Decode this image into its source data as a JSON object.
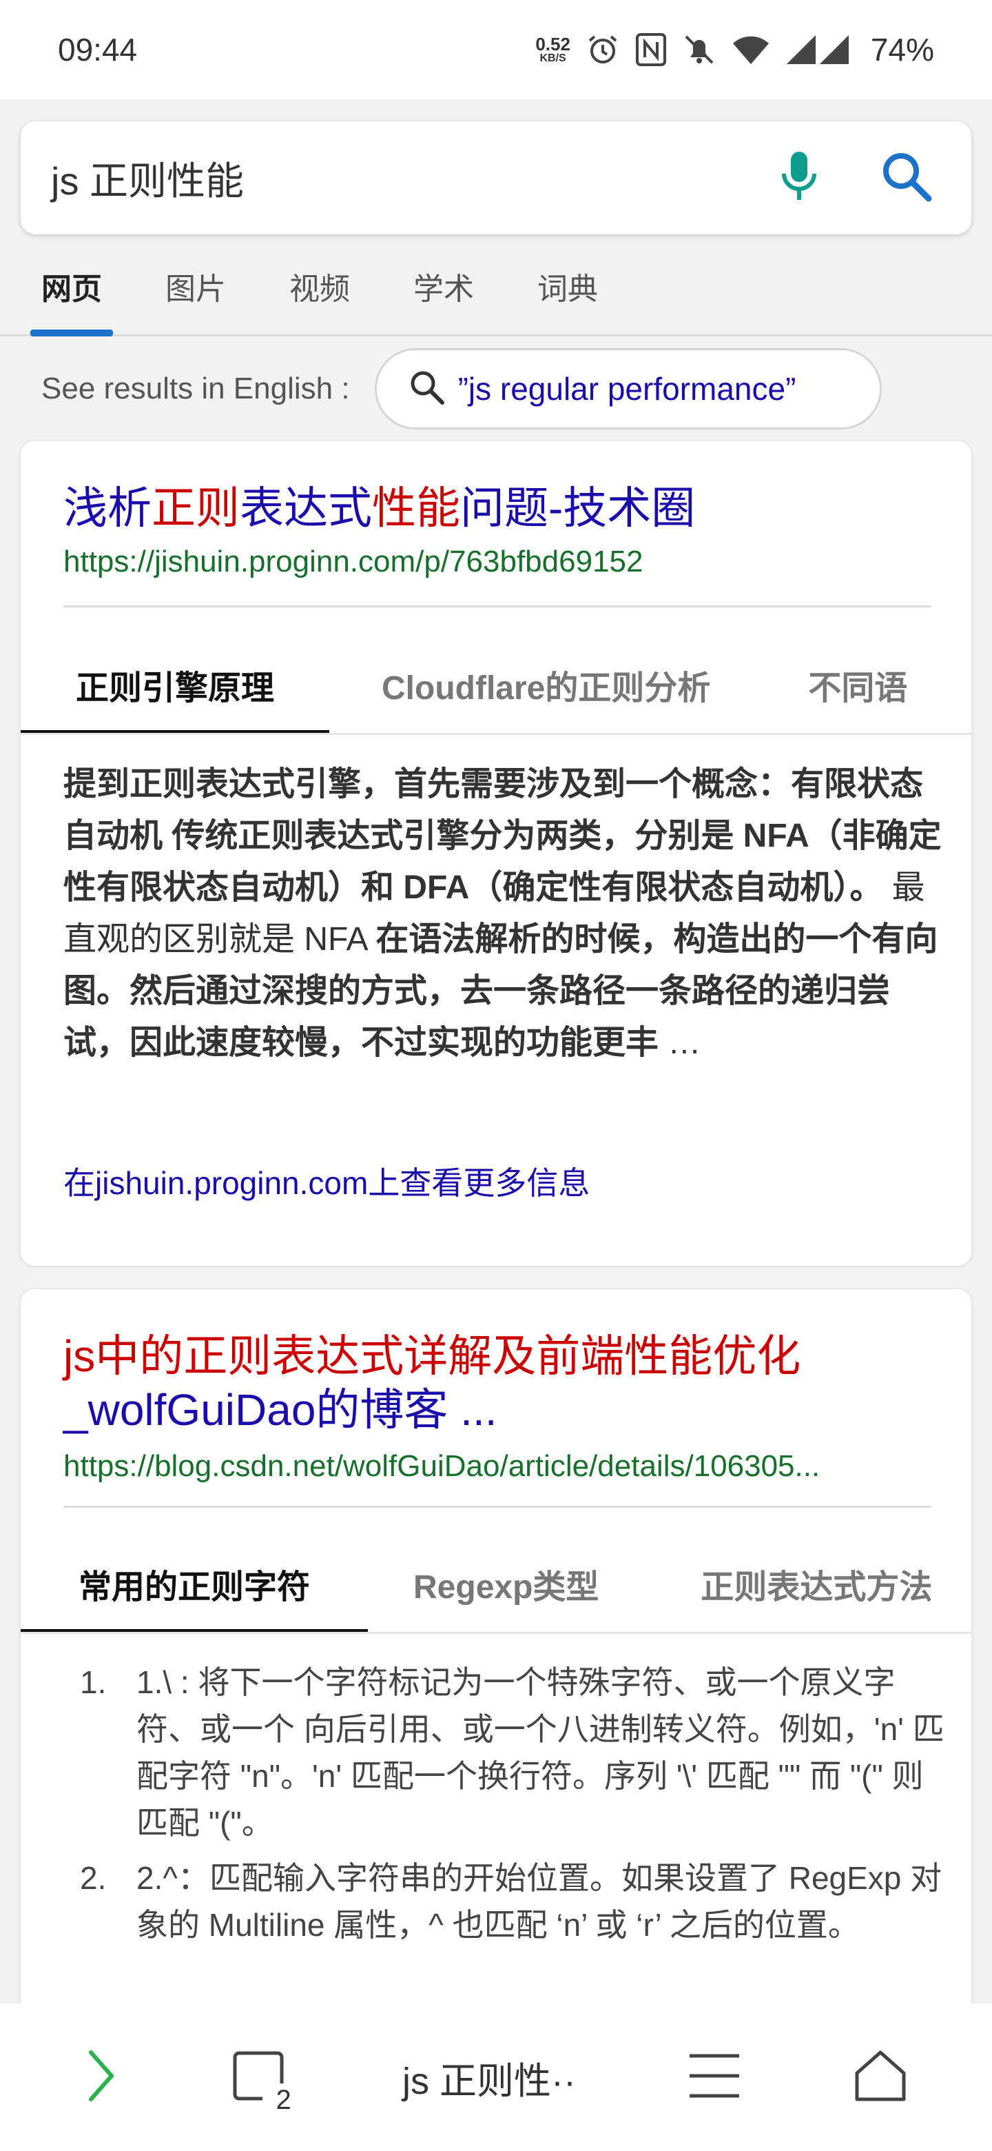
{
  "status_bar": {
    "time": "09:44",
    "net_speed": "0.52",
    "net_unit": "KB/S",
    "battery": "74%"
  },
  "search": {
    "query": "js 正则性能"
  },
  "search_tabs": [
    "网页",
    "图片",
    "视频",
    "学术",
    "词典"
  ],
  "english": {
    "label": "See results in English :",
    "suggestion": "”js regular performance”"
  },
  "results": [
    {
      "title_parts": [
        "浅析",
        "正则",
        "表达式",
        "性能",
        "问题-技术圈"
      ],
      "url": "https://jishuin.proginn.com/p/763bfbd69152",
      "tabs": [
        "正则引擎原理",
        "Cloudflare的正则分析",
        "不同语"
      ],
      "snippet_parts": [
        "提到正则表达式引擎，首先需要涉及到一个概念：有限状态自动机 传统正则表达式引擎分为两类，分别是 NFA（非确定性有限状态自动机）和 DFA（确定性有限状态自动机）。",
        " 最直观的区别就是 NFA ",
        "在语法解析的时候，构造出的一个有向图。然后通过深搜的方式，去一条路径一条路径的递归尝试，因此速度较慢，不过实现的功能更丰",
        " …"
      ],
      "more_link": "在jishuin.proginn.com上查看更多信息"
    },
    {
      "title_parts": [
        "js中的正则表达式详解及前端性能优化",
        "_wolfGuiDao的博客 ..."
      ],
      "url": "https://blog.csdn.net/wolfGuiDao/article/details/106305...",
      "tabs": [
        "常用的正则字符",
        "Regexp类型",
        "正则表达式方法"
      ],
      "list_items": [
        {
          "num": "1.",
          "text": "1.\\ : 将下一个字符标记为一个特殊字符、或一个原义字符、或一个 向后引用、或一个八进制转义符。例如，'n' 匹配字符 \"n\"。'n' 匹配一个换行符。序列 '\\' 匹配 \"\" 而 \"(\" 则匹配 \"(\"。"
        },
        {
          "num": "2.",
          "text": "2.^：匹配输入字符串的开始位置。如果设置了 RegExp 对象的 Multiline 属性，^ 也匹配 ‘n’ 或 ‘r’ 之后的位置。"
        }
      ]
    }
  ],
  "bottom_nav": {
    "tab_count": "2",
    "title": "js 正则性··"
  },
  "colors": {
    "link": "#1a0dab",
    "highlight": "#cc0000",
    "url": "#16702c",
    "accent": "#1a73c8",
    "mic": "#0e9e8e",
    "forward_arrow": "#2bb24c"
  },
  "icons": [
    "alarm-icon",
    "nfc-icon",
    "mute-icon",
    "wifi-icon",
    "signal-icon",
    "mic-icon",
    "search-icon",
    "forward-icon",
    "tabs-icon",
    "menu-icon",
    "home-icon"
  ]
}
